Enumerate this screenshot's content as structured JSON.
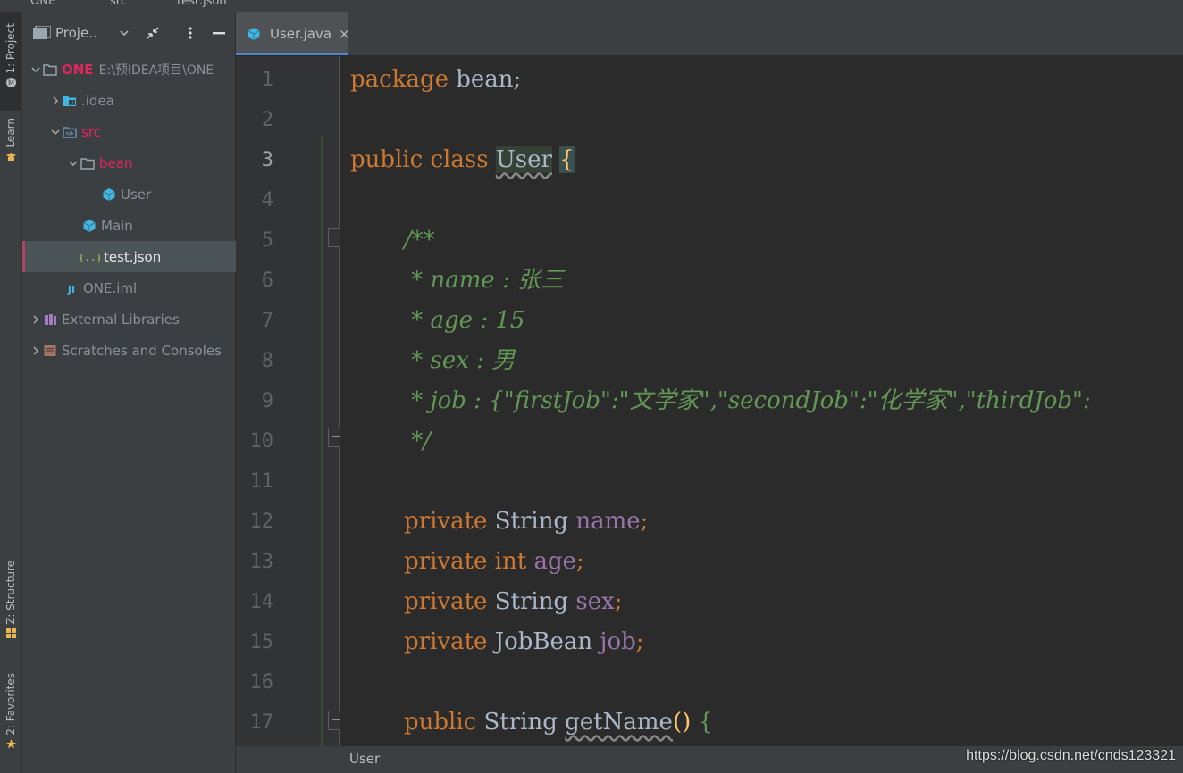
{
  "topbar": {
    "crumbs": [
      "ONE",
      "src",
      "test.json"
    ]
  },
  "toolwindows": {
    "project": "1: Project",
    "learn": "Learn",
    "structure": "Z: Structure",
    "favorites": "2: Favorites"
  },
  "project_panel": {
    "title": "Proje..",
    "tree": [
      {
        "label": "ONE",
        "hint": "E:\\预IDEA项目\\ONE",
        "icon": "folder-icon"
      },
      {
        "label": ".idea",
        "icon": "idea-folder-icon"
      },
      {
        "label": "src",
        "icon": "source-folder-icon"
      },
      {
        "label": "bean",
        "icon": "folder-icon"
      },
      {
        "label": "User",
        "icon": "java-class-icon"
      },
      {
        "label": "Main",
        "icon": "java-class-icon"
      },
      {
        "label": "test.json",
        "icon": "json-file-icon"
      },
      {
        "label": "ONE.iml",
        "icon": "iml-file-icon"
      },
      {
        "label": "External Libraries",
        "icon": "library-icon"
      },
      {
        "label": "Scratches and Consoles",
        "icon": "scratches-icon"
      }
    ]
  },
  "editor": {
    "tab": {
      "label": "User.java",
      "close": "×"
    },
    "line_numbers": [
      "1",
      "2",
      "3",
      "4",
      "5",
      "6",
      "7",
      "8",
      "9",
      "10",
      "11",
      "12",
      "13",
      "14",
      "15",
      "16",
      "17"
    ],
    "current_line": 3,
    "code": {
      "l1": {
        "kw": "package",
        "rest": " bean;"
      },
      "l3": {
        "kw": "public class",
        "cls": "User",
        "brace": "{"
      },
      "l5": "/**",
      "l6": " * name : 张三",
      "l7": " * age : 15",
      "l8": " * sex : 男",
      "l9": " * job : {\"firstJob\":\"文学家\",\"secondJob\":\"化学家\",\"thirdJob\":",
      "l10": " */",
      "l12": {
        "kw": "private",
        "type": "String",
        "field": "name",
        "end": ";"
      },
      "l13": {
        "kw": "private int",
        "type": "",
        "field": "age",
        "end": ";"
      },
      "l14": {
        "kw": "private",
        "type": "String",
        "field": "sex",
        "end": ";"
      },
      "l15": {
        "kw": "private",
        "type": "JobBean",
        "field": "job",
        "end": ";"
      },
      "l17": {
        "kw": "public",
        "type": "String",
        "method": "getName",
        "parens": "()",
        "brace": "{"
      }
    }
  },
  "statusbar": {
    "breadcrumb": "User"
  },
  "watermark": "https://blog.csdn.net/cnds123321",
  "colors": {
    "keyword": "#cc7832",
    "comment": "#629755",
    "field": "#9876aa",
    "brace": "#ffc66d",
    "accent": "#4a88c7",
    "selection_marker": "#b3426b"
  }
}
